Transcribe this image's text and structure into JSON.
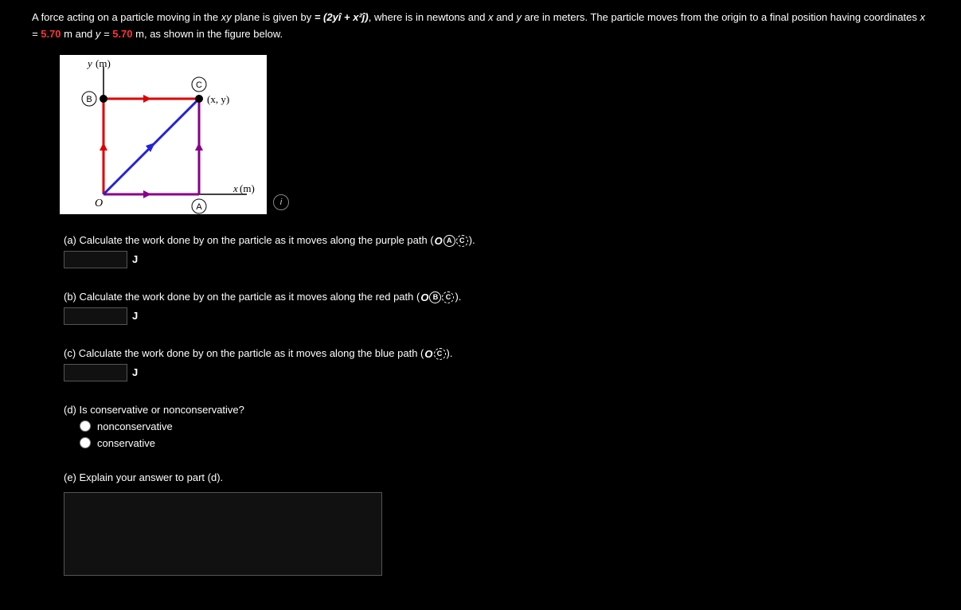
{
  "problem": {
    "intro_a": "A force acting on a particle moving in the ",
    "plane": "xy",
    "intro_b": " plane is given by ",
    "force_expr": "= (2yî + x²ĵ)",
    "intro_c": ", where ",
    "intro_d": " is in newtons and ",
    "xvar": "x",
    "intro_e": " and ",
    "yvar": "y",
    "intro_f": " are in meters. The particle moves from the origin to a final position having coordinates ",
    "xlabel": "x = ",
    "xval": "5.70",
    "yand": " m and ",
    "ylabel": "y = ",
    "yval": "5.70",
    "intro_g": " m, as shown in the figure below."
  },
  "figure": {
    "y_axis": "y (m)",
    "x_axis": "x (m)",
    "origin": "O",
    "point_xy": "(x, y)",
    "labelA": "A",
    "labelB": "B",
    "labelC": "C"
  },
  "parts": {
    "a": {
      "text": "(a) Calculate the work done by ",
      "text2": " on the particle as it moves along the purple path (",
      "path_o": "O",
      "path_mid": "A",
      "path_end": "C",
      "text3": ").",
      "unit": "J"
    },
    "b": {
      "text": "(b) Calculate the work done by ",
      "text2": " on the particle as it moves along the red path (",
      "path_o": "O",
      "path_mid": "B",
      "path_end": "C",
      "text3": ").",
      "unit": "J"
    },
    "c": {
      "text": "(c) Calculate the work done by ",
      "text2": " on the particle as it moves along the blue path (",
      "path_o": "O",
      "path_end": "C",
      "text3": ").",
      "unit": "J"
    },
    "d": {
      "text": "(d) Is ",
      "text2": " conservative or nonconservative?",
      "opt1": "nonconservative",
      "opt2": "conservative"
    },
    "e": {
      "text": "(e) Explain your answer to part (d)."
    }
  }
}
